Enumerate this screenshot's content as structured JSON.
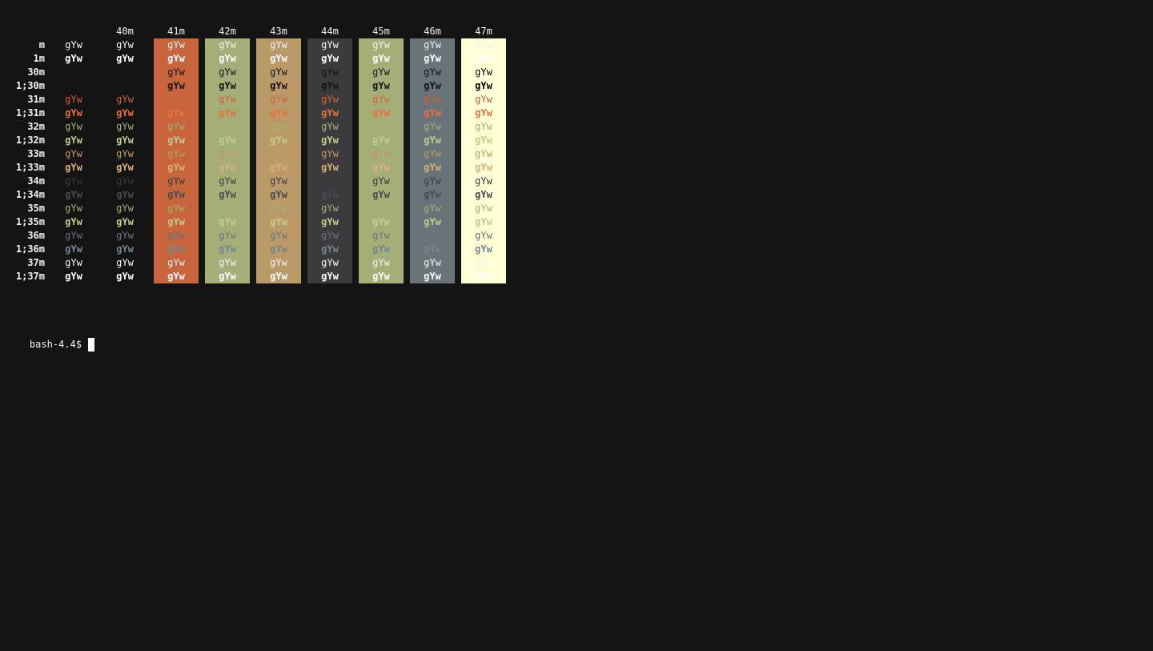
{
  "terminal": {
    "prompt": "bash-4.4$",
    "sample_text": "gYw",
    "colors": {
      "background": "#141414",
      "default_fg": "#f2f2f2",
      "bold_fg": "#ffffff",
      "fg30": "#141414",
      "fg31": "#c8653c",
      "fg31_bold": "#e8713e",
      "fg32": "#a6ae78",
      "fg32_bold": "#c3cb8f",
      "fg33": "#bb9a68",
      "fg33_bold": "#d9b078",
      "fg34": "#3b3b3d",
      "fg34_bold": "#4a4a4e",
      "fg35": "#a6ae78",
      "fg35_bold": "#c3cb8f",
      "fg36": "#68747a",
      "fg36_bold": "#77858c",
      "fg37": "#f2f2f2",
      "bg41": "#c8653c",
      "bg42": "#a6ae78",
      "bg43": "#bb9a68",
      "bg44": "#3b3b3d",
      "bg45": "#a6ae78",
      "bg46": "#68747a",
      "bg47": "#ffffd6"
    },
    "column_headers": [
      "",
      "40m",
      "41m",
      "42m",
      "43m",
      "44m",
      "45m",
      "46m",
      "47m"
    ],
    "row_labels": [
      "m",
      "1m",
      "30m",
      "1;30m",
      "31m",
      "1;31m",
      "32m",
      "1;32m",
      "33m",
      "1;33m",
      "34m",
      "1;34m",
      "35m",
      "1;35m",
      "36m",
      "1;36m",
      "37m",
      "1;37m"
    ]
  }
}
